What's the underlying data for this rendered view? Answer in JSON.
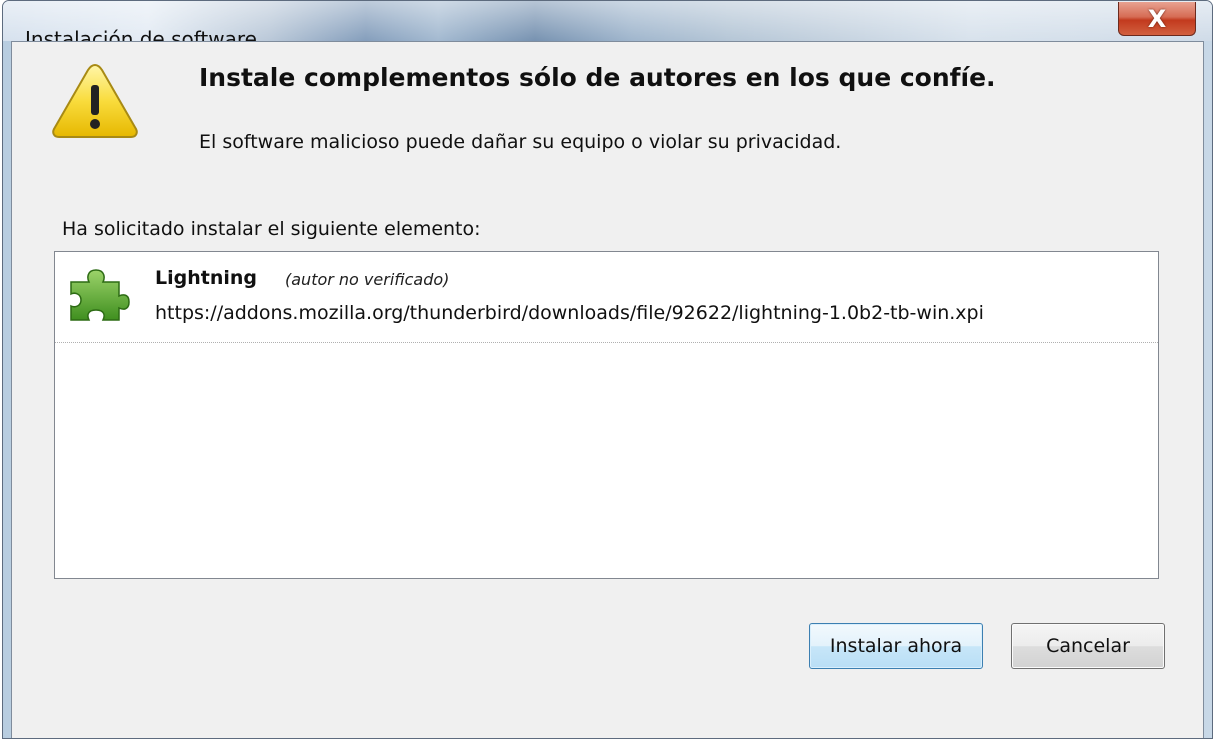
{
  "window": {
    "title": "Instalación de software",
    "close_label": "X"
  },
  "warning": {
    "icon": "warning-icon",
    "heading": "Instale complementos sólo de autores en los que confíe.",
    "subheading": "El software malicioso puede dañar su equipo o violar su privacidad."
  },
  "request": {
    "label": "Ha solicitado instalar el siguiente elemento:"
  },
  "items": [
    {
      "icon": "puzzle-piece-icon",
      "name": "Lightning",
      "note": "(autor no verificado)",
      "url": "https://addons.mozilla.org/thunderbird/downloads/file/92622/lightning-1.0b2-tb-win.xpi"
    }
  ],
  "buttons": {
    "install": "Instalar ahora",
    "cancel": "Cancelar"
  }
}
